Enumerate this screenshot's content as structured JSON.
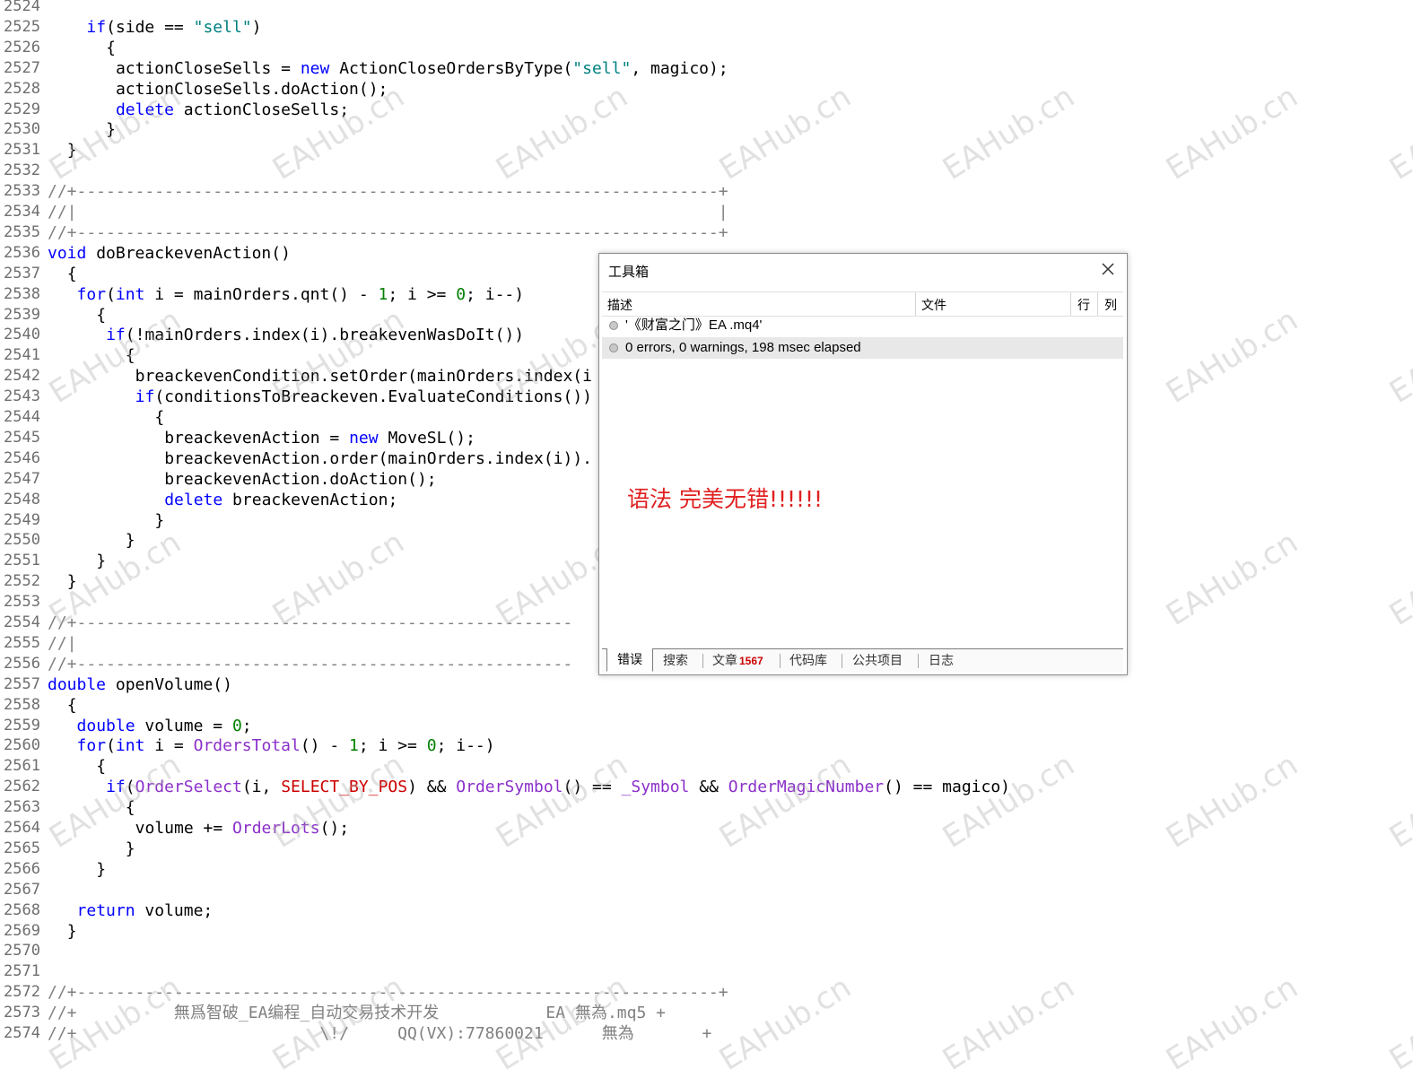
{
  "editor": {
    "lines": [
      {
        "n": "2524",
        "indent": 0,
        "tokens": []
      },
      {
        "n": "2525",
        "indent": 4,
        "tokens": [
          [
            "kw",
            "if"
          ],
          [
            "plain",
            "(side == "
          ],
          [
            "str",
            "\"sell\""
          ],
          [
            "plain",
            ")"
          ]
        ]
      },
      {
        "n": "2526",
        "indent": 6,
        "tokens": [
          [
            "plain",
            "{"
          ]
        ]
      },
      {
        "n": "2527",
        "indent": 7,
        "tokens": [
          [
            "plain",
            "actionCloseSells = "
          ],
          [
            "kw",
            "new"
          ],
          [
            "plain",
            " ActionCloseOrdersByType("
          ],
          [
            "str",
            "\"sell\""
          ],
          [
            "plain",
            ", magico);"
          ]
        ]
      },
      {
        "n": "2528",
        "indent": 7,
        "tokens": [
          [
            "plain",
            "actionCloseSells.doAction();"
          ]
        ]
      },
      {
        "n": "2529",
        "indent": 7,
        "tokens": [
          [
            "kw",
            "delete"
          ],
          [
            "plain",
            " actionCloseSells;"
          ]
        ]
      },
      {
        "n": "2530",
        "indent": 6,
        "tokens": [
          [
            "plain",
            "}"
          ]
        ]
      },
      {
        "n": "2531",
        "indent": 2,
        "tokens": [
          [
            "plain",
            "}"
          ]
        ]
      },
      {
        "n": "2532",
        "indent": 0,
        "tokens": []
      },
      {
        "n": "2533",
        "indent": 0,
        "tokens": [
          [
            "cm",
            "//+------------------------------------------------------------------+"
          ]
        ]
      },
      {
        "n": "2534",
        "indent": 0,
        "tokens": [
          [
            "cm",
            "//|                                                                  |"
          ]
        ]
      },
      {
        "n": "2535",
        "indent": 0,
        "tokens": [
          [
            "cm",
            "//+------------------------------------------------------------------+"
          ]
        ]
      },
      {
        "n": "2536",
        "indent": 0,
        "tokens": [
          [
            "kw",
            "void"
          ],
          [
            "plain",
            " doBreackevenAction()"
          ]
        ]
      },
      {
        "n": "2537",
        "indent": 2,
        "tokens": [
          [
            "plain",
            "{"
          ]
        ]
      },
      {
        "n": "2538",
        "indent": 3,
        "tokens": [
          [
            "kw",
            "for"
          ],
          [
            "plain",
            "("
          ],
          [
            "kw",
            "int"
          ],
          [
            "plain",
            " i = mainOrders.qnt() - "
          ],
          [
            "num",
            "1"
          ],
          [
            "plain",
            "; i >= "
          ],
          [
            "num",
            "0"
          ],
          [
            "plain",
            "; i--)"
          ]
        ]
      },
      {
        "n": "2539",
        "indent": 5,
        "tokens": [
          [
            "plain",
            "{"
          ]
        ]
      },
      {
        "n": "2540",
        "indent": 6,
        "tokens": [
          [
            "kw",
            "if"
          ],
          [
            "plain",
            "(!mainOrders.index(i).breakevenWasDoIt())"
          ]
        ]
      },
      {
        "n": "2541",
        "indent": 8,
        "tokens": [
          [
            "plain",
            "{"
          ]
        ]
      },
      {
        "n": "2542",
        "indent": 9,
        "tokens": [
          [
            "plain",
            "breackevenCondition.setOrder(mainOrders.index(i"
          ]
        ]
      },
      {
        "n": "2543",
        "indent": 9,
        "tokens": [
          [
            "kw",
            "if"
          ],
          [
            "plain",
            "(conditionsToBreackeven.EvaluateConditions())"
          ]
        ]
      },
      {
        "n": "2544",
        "indent": 11,
        "tokens": [
          [
            "plain",
            "{"
          ]
        ]
      },
      {
        "n": "2545",
        "indent": 12,
        "tokens": [
          [
            "plain",
            "breackevenAction = "
          ],
          [
            "kw",
            "new"
          ],
          [
            "plain",
            " MoveSL();"
          ]
        ]
      },
      {
        "n": "2546",
        "indent": 12,
        "tokens": [
          [
            "plain",
            "breackevenAction.order(mainOrders.index(i))."
          ]
        ]
      },
      {
        "n": "2547",
        "indent": 12,
        "tokens": [
          [
            "plain",
            "breackevenAction.doAction();"
          ]
        ]
      },
      {
        "n": "2548",
        "indent": 12,
        "tokens": [
          [
            "kw",
            "delete"
          ],
          [
            "plain",
            " breackevenAction;"
          ]
        ]
      },
      {
        "n": "2549",
        "indent": 11,
        "tokens": [
          [
            "plain",
            "}"
          ]
        ]
      },
      {
        "n": "2550",
        "indent": 8,
        "tokens": [
          [
            "plain",
            "}"
          ]
        ]
      },
      {
        "n": "2551",
        "indent": 5,
        "tokens": [
          [
            "plain",
            "}"
          ]
        ]
      },
      {
        "n": "2552",
        "indent": 2,
        "tokens": [
          [
            "plain",
            "}"
          ]
        ]
      },
      {
        "n": "2553",
        "indent": 0,
        "tokens": []
      },
      {
        "n": "2554",
        "indent": 0,
        "tokens": [
          [
            "cm",
            "//+---------------------------------------------------"
          ]
        ]
      },
      {
        "n": "2555",
        "indent": 0,
        "tokens": [
          [
            "cm",
            "//|"
          ]
        ]
      },
      {
        "n": "2556",
        "indent": 0,
        "tokens": [
          [
            "cm",
            "//+---------------------------------------------------"
          ]
        ]
      },
      {
        "n": "2557",
        "indent": 0,
        "tokens": [
          [
            "kw",
            "double"
          ],
          [
            "plain",
            " openVolume()"
          ]
        ]
      },
      {
        "n": "2558",
        "indent": 2,
        "tokens": [
          [
            "plain",
            "{"
          ]
        ]
      },
      {
        "n": "2559",
        "indent": 3,
        "tokens": [
          [
            "kw",
            "double"
          ],
          [
            "plain",
            " volume = "
          ],
          [
            "num",
            "0"
          ],
          [
            "plain",
            ";"
          ]
        ]
      },
      {
        "n": "2560",
        "indent": 3,
        "tokens": [
          [
            "kw",
            "for"
          ],
          [
            "plain",
            "("
          ],
          [
            "kw",
            "int"
          ],
          [
            "plain",
            " i = "
          ],
          [
            "fn",
            "OrdersTotal"
          ],
          [
            "plain",
            "() - "
          ],
          [
            "num",
            "1"
          ],
          [
            "plain",
            "; i >= "
          ],
          [
            "num",
            "0"
          ],
          [
            "plain",
            "; i--)"
          ]
        ]
      },
      {
        "n": "2561",
        "indent": 5,
        "tokens": [
          [
            "plain",
            "{"
          ]
        ]
      },
      {
        "n": "2562",
        "indent": 6,
        "tokens": [
          [
            "kw",
            "if"
          ],
          [
            "plain",
            "("
          ],
          [
            "fn",
            "OrderSelect"
          ],
          [
            "plain",
            "(i, "
          ],
          [
            "const",
            "SELECT_BY_POS"
          ],
          [
            "plain",
            ") && "
          ],
          [
            "fn",
            "OrderSymbol"
          ],
          [
            "plain",
            "() == "
          ],
          [
            "fn",
            "_Symbol"
          ],
          [
            "plain",
            " && "
          ],
          [
            "fn",
            "OrderMagicNumber"
          ],
          [
            "plain",
            "() == magico)"
          ]
        ]
      },
      {
        "n": "2563",
        "indent": 8,
        "tokens": [
          [
            "plain",
            "{"
          ]
        ]
      },
      {
        "n": "2564",
        "indent": 9,
        "tokens": [
          [
            "plain",
            "volume += "
          ],
          [
            "fn",
            "OrderLots"
          ],
          [
            "plain",
            "();"
          ]
        ]
      },
      {
        "n": "2565",
        "indent": 8,
        "tokens": [
          [
            "plain",
            "}"
          ]
        ]
      },
      {
        "n": "2566",
        "indent": 5,
        "tokens": [
          [
            "plain",
            "}"
          ]
        ]
      },
      {
        "n": "2567",
        "indent": 0,
        "tokens": []
      },
      {
        "n": "2568",
        "indent": 3,
        "tokens": [
          [
            "kw",
            "return"
          ],
          [
            "plain",
            " volume;"
          ]
        ]
      },
      {
        "n": "2569",
        "indent": 2,
        "tokens": [
          [
            "plain",
            "}"
          ]
        ]
      },
      {
        "n": "2570",
        "indent": 0,
        "tokens": []
      },
      {
        "n": "2571",
        "indent": 0,
        "tokens": []
      },
      {
        "n": "2572",
        "indent": 0,
        "tokens": [
          [
            "cm",
            "//+------------------------------------------------------------------+"
          ]
        ]
      },
      {
        "n": "2573",
        "indent": 0,
        "tokens": [
          [
            "cm",
            "//+          無爲智破_EA编程_自动交易技术开发           EA 無為.mq5 +"
          ]
        ]
      },
      {
        "n": "2574",
        "indent": 0,
        "tokens": [
          [
            "cm",
            "//+                         \\!/     QQ(VX):77860021      無為       +"
          ]
        ]
      }
    ]
  },
  "watermark": {
    "text": "EAHub.cn"
  },
  "toolbox": {
    "title": "工具箱",
    "columns": {
      "description": "描述",
      "file": "文件",
      "line": "行",
      "column": "列"
    },
    "messages": [
      "'《财富之门》EA .mq4'",
      "0 errors, 0 warnings, 198 msec elapsed"
    ],
    "note": "语法 完美无错!!!!!!",
    "tabs": [
      {
        "label": "错误",
        "badge": ""
      },
      {
        "label": "搜索",
        "badge": ""
      },
      {
        "label": "文章",
        "badge": "1567"
      },
      {
        "label": "代码库",
        "badge": ""
      },
      {
        "label": "公共项目",
        "badge": ""
      },
      {
        "label": "日志",
        "badge": ""
      }
    ]
  }
}
